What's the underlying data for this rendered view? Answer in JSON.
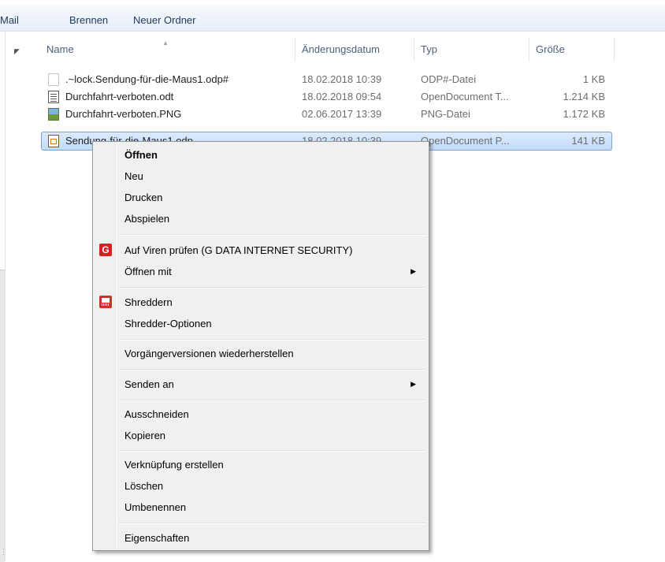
{
  "toolbar": {
    "partial_item": "Mail",
    "items": [
      "Brennen",
      "Neuer Ordner"
    ]
  },
  "columns": {
    "name": "Name",
    "date": "Änderungsdatum",
    "type": "Typ",
    "size": "Größe"
  },
  "files": [
    {
      "name": ".~lock.Sendung-für-die-Maus1.odp#",
      "date": "18.02.2018 10:39",
      "type": "ODP#-Datei",
      "size": "1 KB",
      "icon": "blank-file-icon"
    },
    {
      "name": "Durchfahrt-verboten.odt",
      "date": "18.02.2018 09:54",
      "type": "OpenDocument T...",
      "size": "1.214 KB",
      "icon": "writer-document-icon"
    },
    {
      "name": "Durchfahrt-verboten.PNG",
      "date": "02.06.2017 13:39",
      "type": "PNG-Datei",
      "size": "1.172 KB",
      "icon": "image-file-icon"
    },
    {
      "name": "Sendung-für-die-Maus1.odp",
      "date": "18.02.2018 10:39",
      "type": "OpenDocument P...",
      "size": "141 KB",
      "icon": "presentation-file-icon",
      "selected": true
    }
  ],
  "context_menu": {
    "open": "Öffnen",
    "new": "Neu",
    "print": "Drucken",
    "play": "Abspielen",
    "virus_scan": "Auf Viren prüfen (G DATA INTERNET SECURITY)",
    "open_with": "Öffnen mit",
    "shred": "Shreddern",
    "shredder_options": "Shredder-Optionen",
    "restore_versions": "Vorgängerversionen wiederherstellen",
    "send_to": "Senden an",
    "cut": "Ausschneiden",
    "copy": "Kopieren",
    "create_shortcut": "Verknüpfung erstellen",
    "delete": "Löschen",
    "rename": "Umbenennen",
    "properties": "Eigenschaften",
    "submenu_arrow": "▶",
    "gdata_icon_glyph": "G"
  },
  "colors": {
    "selection": "#c1dbfc",
    "menu_background": "#f0f0f0",
    "gdata_red": "#d81e1e"
  }
}
